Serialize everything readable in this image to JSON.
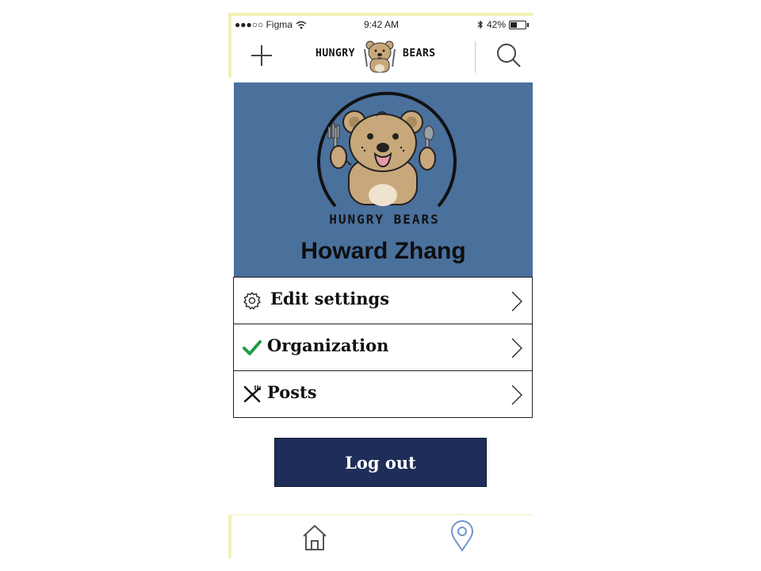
{
  "status_bar": {
    "carrier": "●●●○○ Figma",
    "time": "9:42 AM",
    "battery_percent": "42%",
    "battery_level": 0.42
  },
  "nav": {
    "logo_left_text": "HUNGRY",
    "logo_right_text": "BEARS",
    "add_icon": "plus-icon",
    "search_icon": "search-icon"
  },
  "profile": {
    "name": "Howard Zhang",
    "logo_text": "HUNGRY BEARS",
    "header_color": "#4a709c"
  },
  "menu": {
    "items": [
      {
        "label": "Edit settings",
        "icon": "gear-icon"
      },
      {
        "label": "Organization",
        "icon": "check-icon",
        "icon_color": "#1f9b4a"
      },
      {
        "label": "Posts",
        "icon": "utensils-icon"
      }
    ]
  },
  "logout": {
    "label": "Log out",
    "color": "#1e2e58"
  },
  "tab_bar": {
    "items": [
      {
        "icon": "home-icon"
      },
      {
        "icon": "map-pin-icon",
        "color": "#6f97c9"
      }
    ]
  }
}
